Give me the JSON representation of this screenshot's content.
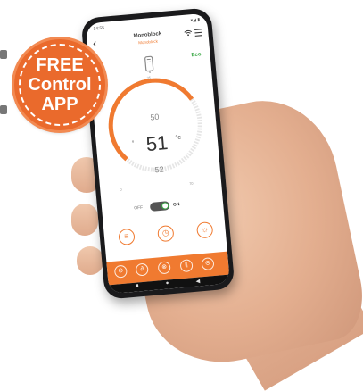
{
  "badge": {
    "line1": "FREE",
    "line2": "Control",
    "line3": "APP",
    "color": "#ea6a2c"
  },
  "status_bar": {
    "time": "14:55",
    "icons": "▾◢ ▮"
  },
  "app": {
    "brand": "Monoblock",
    "subtitle": "Monoblock",
    "back_icon": "‹",
    "wifi_icon": "wifi",
    "menu_icon": "☰",
    "eco_label": "Eco",
    "accent": "#f07a30"
  },
  "thermostat": {
    "set_temp": "50",
    "current_temp": "51",
    "unit_left": "°",
    "unit_right": "°c",
    "low_temp": "52",
    "scale_min": "0",
    "scale_max": "70",
    "scale_top": "35",
    "arc_fill_fraction": 0.72
  },
  "power": {
    "off_label": "OFF",
    "on_label": "ON",
    "state": "on"
  },
  "quick_actions": [
    "list-icon",
    "clock-icon",
    "sun-icon"
  ],
  "bottom_nav": [
    "thermometer-icon",
    "timer-icon",
    "gear-icon",
    "chart-icon",
    "drop-icon"
  ],
  "system_nav": {
    "home": "■",
    "circle": "●",
    "back": "◀"
  }
}
